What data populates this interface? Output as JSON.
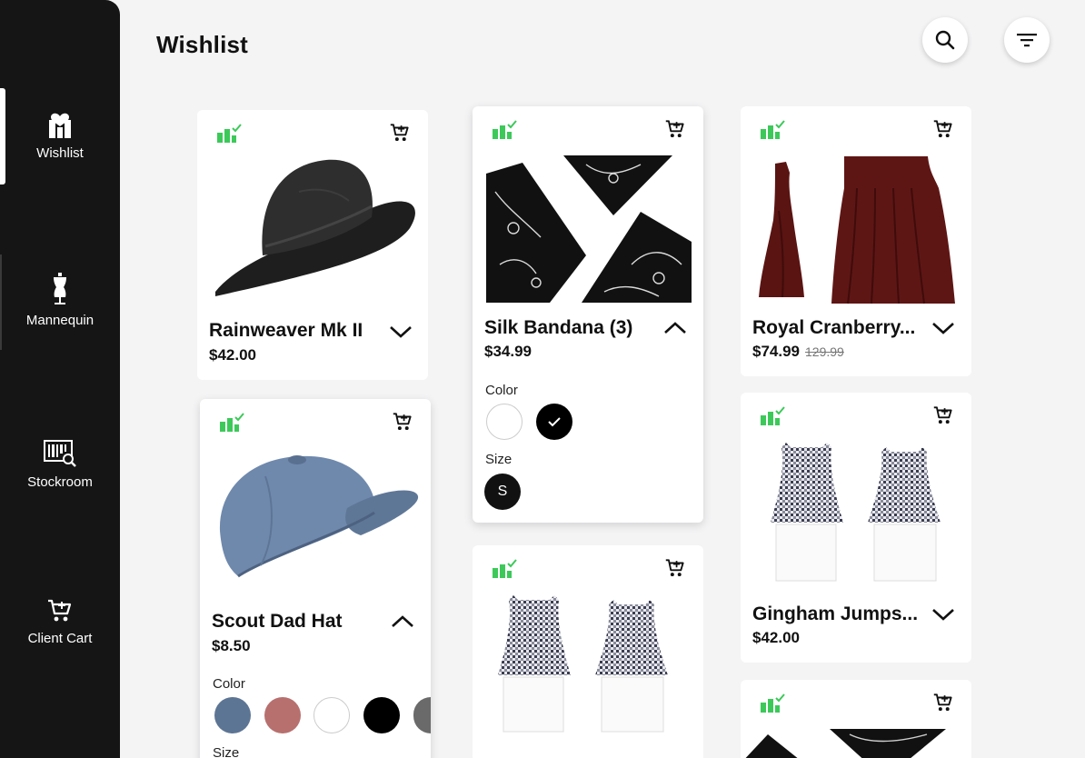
{
  "sidebar": {
    "items": [
      {
        "label": "Wishlist",
        "icon": "wishlist-icon",
        "active": true
      },
      {
        "label": "Mannequin",
        "icon": "mannequin-icon"
      },
      {
        "label": "Stockroom",
        "icon": "stockroom-icon"
      },
      {
        "label": "Client Cart",
        "icon": "client-cart-icon"
      }
    ]
  },
  "header": {
    "title": "Wishlist",
    "search_icon": "search-icon",
    "filter_icon": "filter-icon"
  },
  "colors": {
    "sidebar_bg": "#151515",
    "page_bg": "#f4f4f5",
    "stock_green": "#3cc95a",
    "swatch_denim": "#5d7594",
    "swatch_rose": "#b7706e",
    "swatch_white": "#ffffff",
    "swatch_black": "#000000",
    "swatch_grey": "#6a6a6a"
  },
  "products": [
    {
      "name": "Rainweaver Mk II",
      "price": "$42.00",
      "expanded": false
    },
    {
      "name": "Scout Dad Hat",
      "price": "$8.50",
      "expanded": true,
      "options": {
        "color_label": "Color",
        "size_label": "Size",
        "colors": [
          "denim",
          "rose",
          "white",
          "black",
          "grey"
        ]
      }
    },
    {
      "name": "Silk Bandana (3)",
      "price": "$34.99",
      "expanded": true,
      "options": {
        "color_label": "Color",
        "size_label": "Size",
        "colors": [
          "white",
          "black"
        ],
        "selected_color": "black",
        "sizes": [
          "S"
        ],
        "selected_size": "S"
      }
    },
    {
      "name": "",
      "price": "",
      "expanded": false
    },
    {
      "name": "Royal Cranberry...",
      "price": "$74.99",
      "original_price": "129.99",
      "expanded": false
    },
    {
      "name": "Gingham Jumps...",
      "price": "$42.00",
      "expanded": false
    },
    {
      "name": "",
      "price": "",
      "expanded": false
    }
  ]
}
